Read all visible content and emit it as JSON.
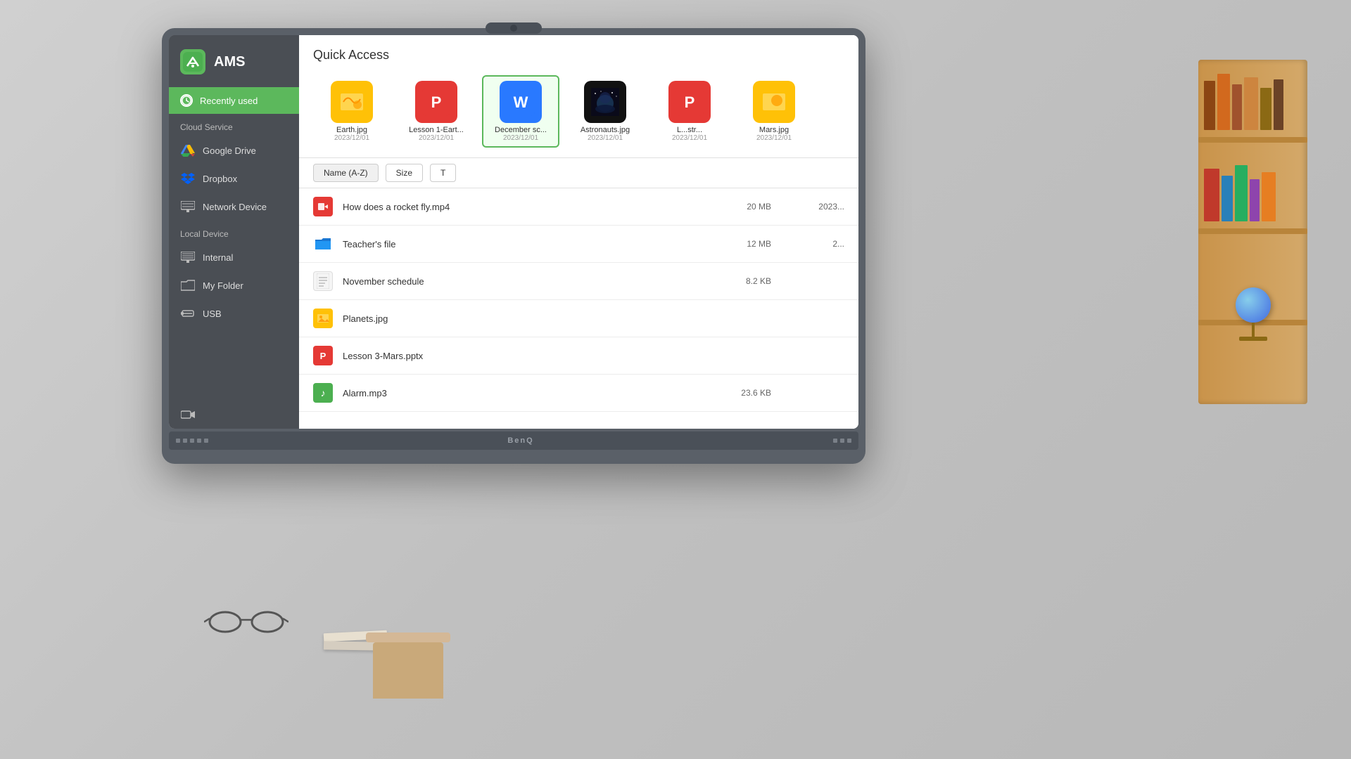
{
  "app": {
    "title": "AMS",
    "logo_char": "📁"
  },
  "sidebar": {
    "recently_used_label": "Recently used",
    "cloud_service_label": "Cloud Service",
    "local_device_label": "Local Device",
    "items": [
      {
        "id": "google-drive",
        "label": "Google Drive",
        "icon": "gdrive"
      },
      {
        "id": "dropbox",
        "label": "Dropbox",
        "icon": "dropbox"
      },
      {
        "id": "network-device",
        "label": "Network Device",
        "icon": "network"
      },
      {
        "id": "internal",
        "label": "Internal",
        "icon": "internal"
      },
      {
        "id": "my-folder",
        "label": "My Folder",
        "icon": "folder"
      },
      {
        "id": "usb",
        "label": "USB",
        "icon": "usb"
      }
    ]
  },
  "main": {
    "quick_access_label": "Quick Access",
    "sort_name_label": "Name (A-Z)",
    "sort_size_label": "Size",
    "sort_time_label": "T",
    "thumbnails": [
      {
        "name": "Earth.jpg",
        "date": "2023/12/01",
        "type": "image",
        "selected": false
      },
      {
        "name": "Lesson 1-Eart...",
        "date": "2023/12/01",
        "type": "ppt",
        "selected": false
      },
      {
        "name": "December sc...",
        "date": "2023/12/01",
        "type": "word",
        "selected": true
      },
      {
        "name": "Astronauts.jpg",
        "date": "2023/12/01",
        "type": "photo",
        "selected": false
      },
      {
        "name": "L...str...",
        "date": "2023/12/01",
        "type": "ppt2",
        "selected": false
      },
      {
        "name": "Mars.jpg",
        "date": "2023/12/01",
        "type": "image2",
        "selected": false
      }
    ],
    "files": [
      {
        "name": "How does a rocket fly.mp4",
        "size": "20 MB",
        "date": "2023...",
        "type": "video"
      },
      {
        "name": "Teacher's file",
        "size": "12 MB",
        "date": "2...",
        "type": "folder"
      },
      {
        "name": "November schedule",
        "size": "8.2 KB",
        "date": "",
        "type": "doc"
      },
      {
        "name": "Planets.jpg",
        "size": "",
        "date": "",
        "type": "image"
      },
      {
        "name": "Lesson 3-Mars.pptx",
        "size": "",
        "date": "",
        "type": "ppt"
      },
      {
        "name": "Alarm.mp3",
        "size": "23.6 KB",
        "date": "",
        "type": "audio"
      }
    ]
  },
  "monitor": {
    "brand": "BenQ",
    "bottom_dots": [
      "dot1",
      "dot2",
      "dot3"
    ]
  }
}
